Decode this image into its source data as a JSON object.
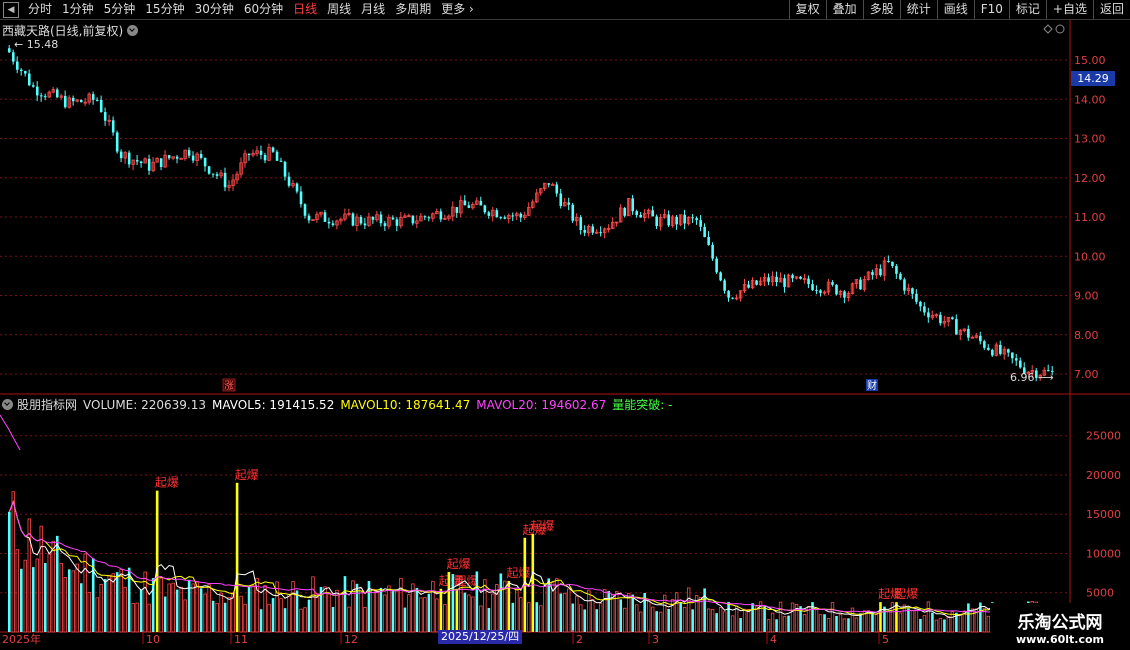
{
  "toolbar": {
    "periods": [
      "分时",
      "1分钟",
      "5分钟",
      "15分钟",
      "30分钟",
      "60分钟",
      "日线",
      "周线",
      "月线",
      "多周期",
      "更多"
    ],
    "active": "日线",
    "buttons": [
      "复权",
      "叠加",
      "多股",
      "统计",
      "画线",
      "F10",
      "标记",
      "+自选",
      "返回"
    ]
  },
  "main": {
    "title": "西藏天路(日线,前复权)",
    "current_price": "14.29",
    "high_label": "15.48",
    "low_label": "6.96",
    "markers": [
      {
        "text": "涨"
      },
      {
        "text": "财"
      }
    ]
  },
  "indicator": {
    "name": "股朋指标网",
    "volume": "VOLUME: 220639.13",
    "mavol5": "MAVOL5: 191415.52",
    "mavol10": "MAVOL10: 187641.47",
    "mavol20": "MAVOL20: 194602.67",
    "signal": "量能突破: -",
    "signal_text": "起爆"
  },
  "axis": {
    "price_ticks": [
      "15.00",
      "14.00",
      "13.00",
      "12.00",
      "11.00",
      "10.00",
      "9.00",
      "8.00",
      "7.00"
    ],
    "volume_ticks": [
      "25000",
      "20000",
      "15000",
      "10000",
      "5000"
    ],
    "date_labels": [
      "2025年",
      "10",
      "11",
      "12",
      "2",
      "3",
      "4",
      "5"
    ],
    "date_badge": "2025/12/25/四"
  },
  "colors": {
    "up": "#ff4a4a",
    "down": "#54ffff",
    "mavol5": "#ffffff",
    "mavol10": "#ffff00",
    "mavol20": "#ff44ff",
    "signal": "#ffff00",
    "badge": "#1a3aa8"
  },
  "watermark": {
    "line1": "乐淘公式网",
    "line2": "www.60lt.com"
  }
}
